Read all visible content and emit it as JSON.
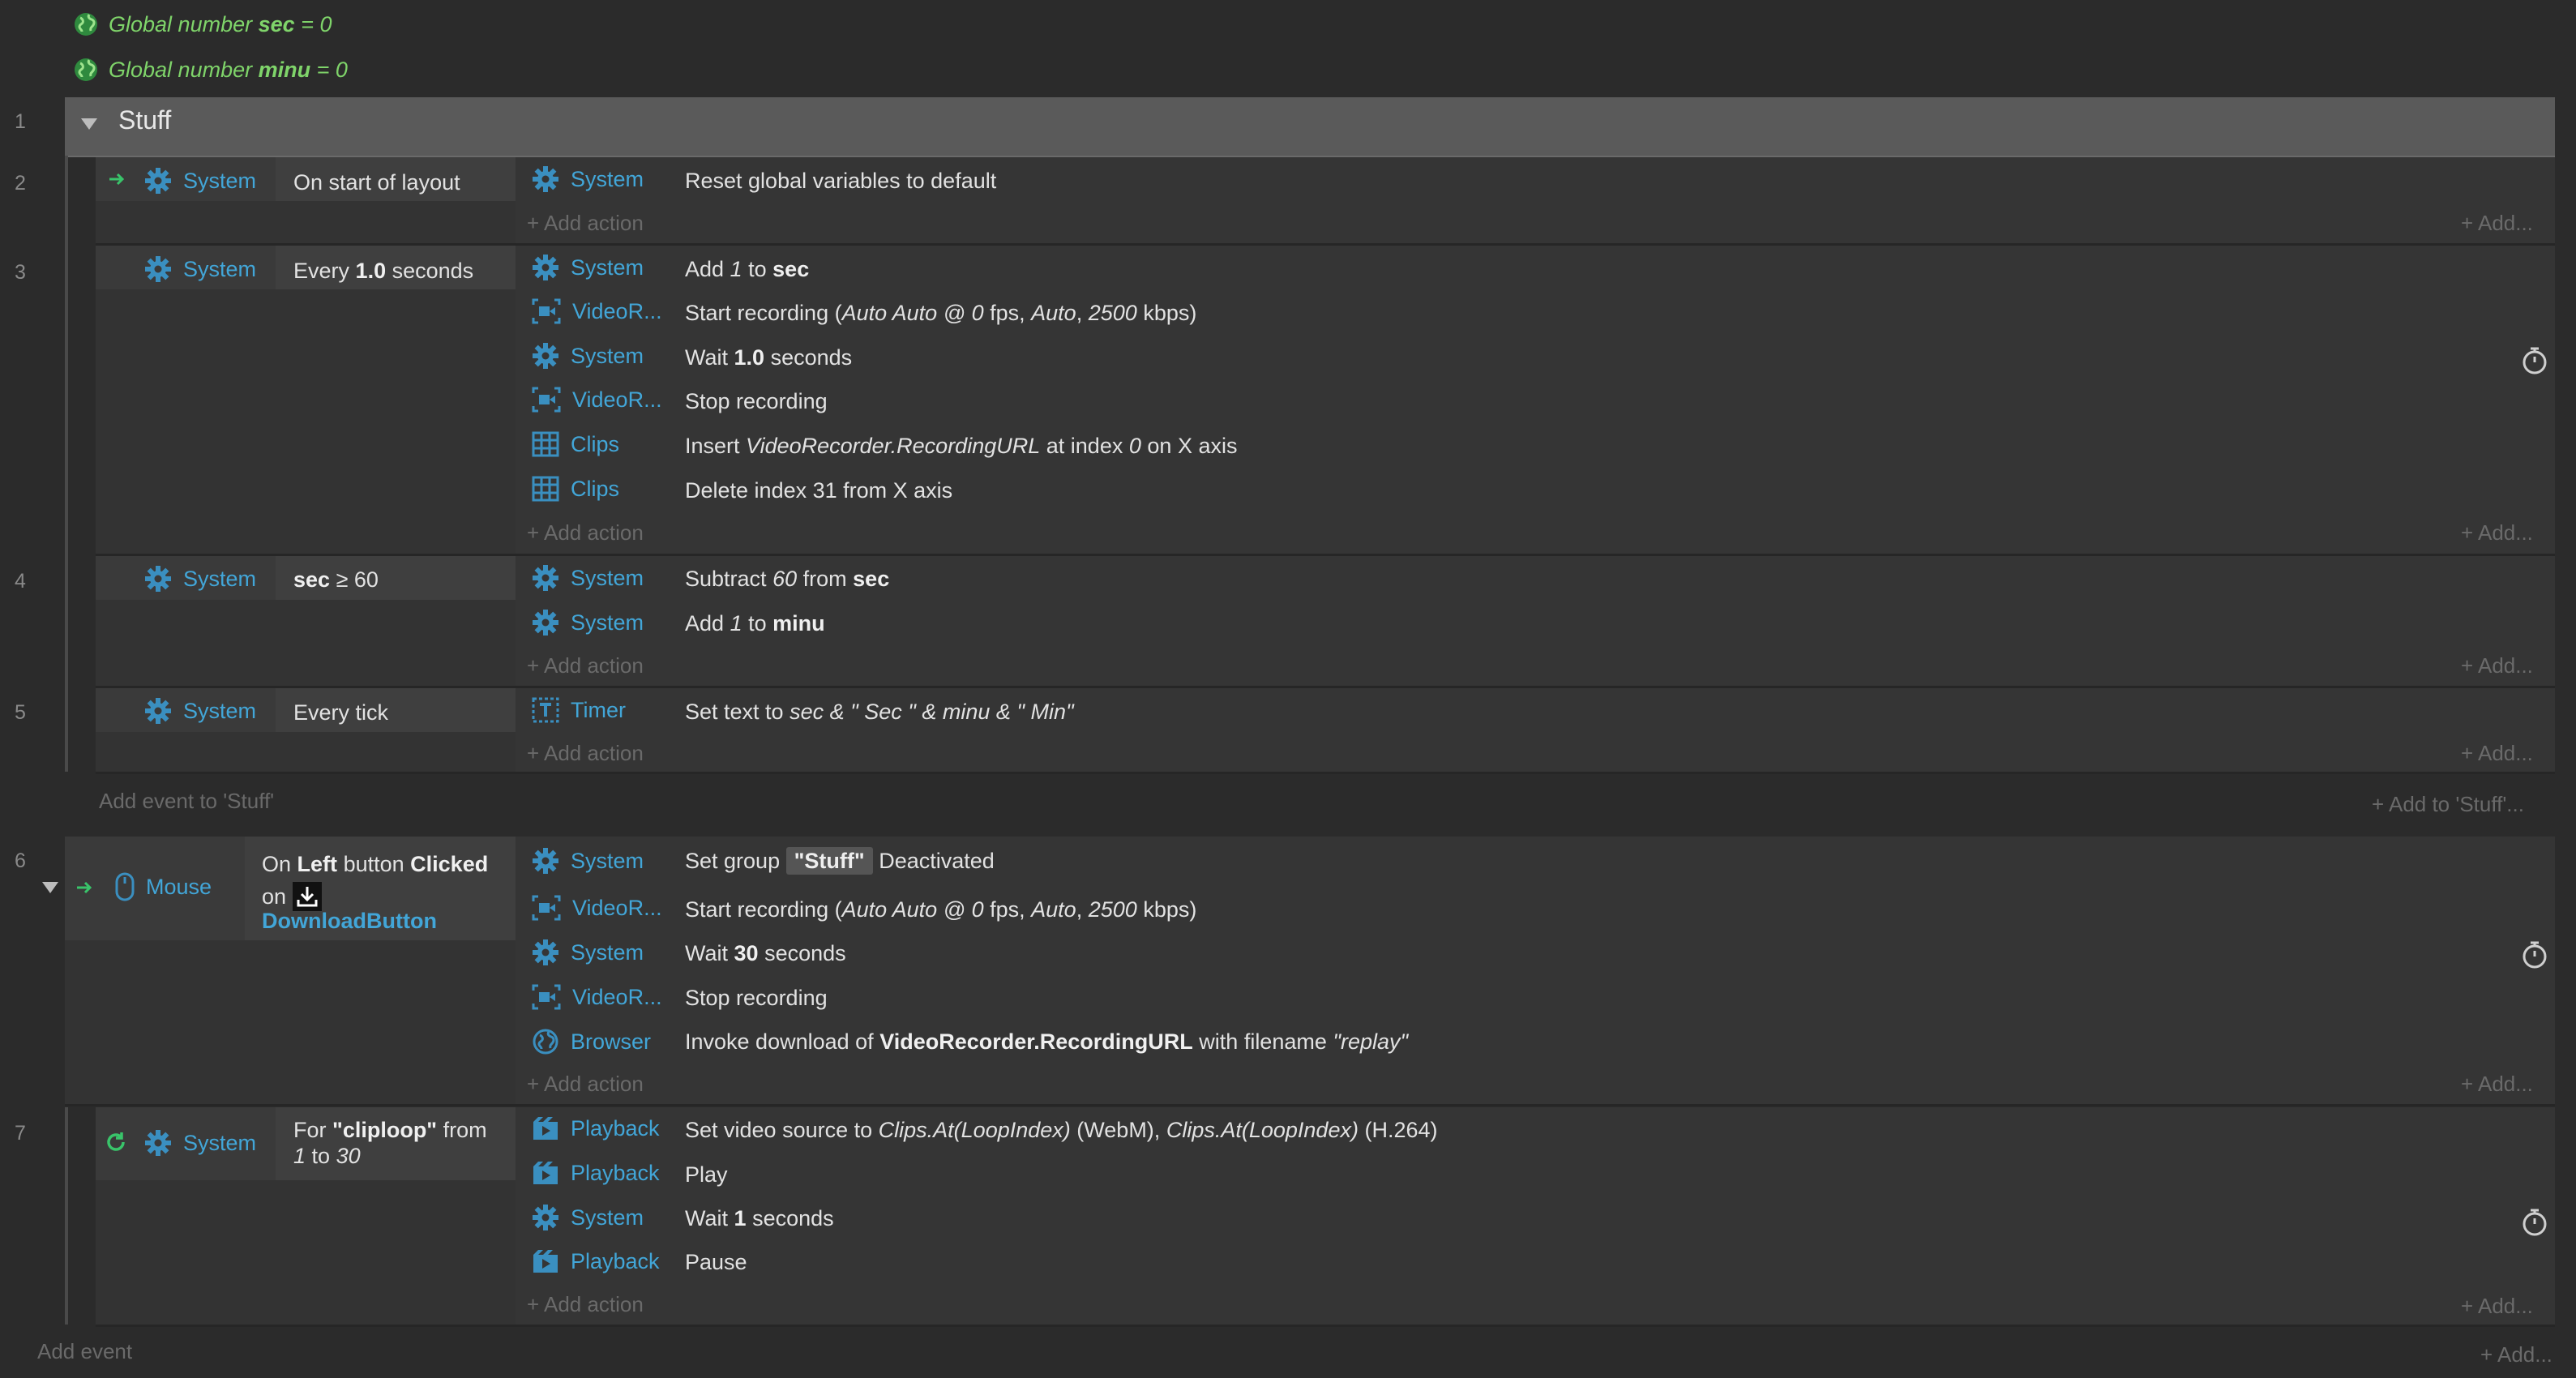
{
  "globals": [
    {
      "prefix": "Global number",
      "name": "sec",
      "suffix": "= 0"
    },
    {
      "prefix": "Global number",
      "name": "minu",
      "suffix": "= 0"
    }
  ],
  "group": {
    "number": "1",
    "title": "Stuff"
  },
  "rows": {
    "r2": {
      "num": "2",
      "obj": "System",
      "cond": "On start of layout"
    },
    "r3": {
      "num": "3",
      "obj": "System",
      "cond_pre": "Every",
      "cond_bold": "1.0",
      "cond_post": "seconds"
    },
    "r4": {
      "num": "4",
      "obj": "System",
      "cond_bold": "sec",
      "cond_post": "≥ 60"
    },
    "r5": {
      "num": "5",
      "obj": "System",
      "cond": "Every tick"
    },
    "r6": {
      "num": "6",
      "obj": "Mouse",
      "c1": "On",
      "c2": "Left",
      "c3": "button",
      "c4": "Clicked",
      "c5": "on",
      "c6": "DownloadButton"
    },
    "r7": {
      "num": "7",
      "obj": "System",
      "c1": "For",
      "c2": "\"cliploop\"",
      "c3": "from",
      "c4": "1",
      "c5": "to",
      "c6": "30"
    }
  },
  "actions": {
    "a2_1": {
      "obj": "System",
      "text": "Reset global variables to default"
    },
    "a3_1": {
      "obj": "System",
      "t1": "Add",
      "t2": "1",
      "t3": "to",
      "t4": "sec"
    },
    "a3_2": {
      "obj": "VideoR...",
      "t1": "Start recording (",
      "t2": "Auto Auto @ 0",
      "t3": "fps,",
      "t4": "Auto",
      "t5": ",",
      "t6": "2500",
      "t7": "kbps)"
    },
    "a3_3": {
      "obj": "System",
      "t1": "Wait",
      "t2": "1.0",
      "t3": "seconds"
    },
    "a3_4": {
      "obj": "VideoR...",
      "text": "Stop recording"
    },
    "a3_5": {
      "obj": "Clips",
      "t1": "Insert",
      "t2": "VideoRecorder.RecordingURL",
      "t3": "at index",
      "t4": "0",
      "t5": "on X axis"
    },
    "a3_6": {
      "obj": "Clips",
      "text": "Delete index 31 from X axis"
    },
    "a4_1": {
      "obj": "System",
      "t1": "Subtract",
      "t2": "60",
      "t3": "from",
      "t4": "sec"
    },
    "a4_2": {
      "obj": "System",
      "t1": "Add",
      "t2": "1",
      "t3": "to",
      "t4": "minu"
    },
    "a5_1": {
      "obj": "Timer",
      "t1": "Set text to",
      "t2": "sec & \" Sec \" & minu & \" Min\""
    },
    "a6_1": {
      "obj": "System",
      "t1": "Set group",
      "t2": "\"Stuff\"",
      "t3": "Deactivated"
    },
    "a6_2": {
      "obj": "VideoR...",
      "t1": "Start recording (",
      "t2": "Auto Auto @ 0",
      "t3": "fps,",
      "t4": "Auto",
      "t5": ",",
      "t6": "2500",
      "t7": "kbps)"
    },
    "a6_3": {
      "obj": "System",
      "t1": "Wait",
      "t2": "30",
      "t3": "seconds"
    },
    "a6_4": {
      "obj": "VideoR...",
      "text": "Stop recording"
    },
    "a6_5": {
      "obj": "Browser",
      "t1": "Invoke download of",
      "t2": "VideoRecorder.RecordingURL",
      "t3": "with filename",
      "t4": "\"replay\""
    },
    "a7_1": {
      "obj": "Playback",
      "t1": "Set video source to",
      "t2": "Clips.At(LoopIndex)",
      "t3": "(WebM),",
      "t4": "Clips.At(LoopIndex)",
      "t5": "(H.264)"
    },
    "a7_2": {
      "obj": "Playback",
      "text": "Play"
    },
    "a7_3": {
      "obj": "System",
      "t1": "Wait",
      "t2": "1",
      "t3": "seconds"
    },
    "a7_4": {
      "obj": "Playback",
      "text": "Pause"
    }
  },
  "labels": {
    "add_action": "+ Add action",
    "add_more": "+ Add...",
    "add_event_group": "Add event to 'Stuff'",
    "add_to_group": "+ Add to 'Stuff'...",
    "add_event": "Add event"
  },
  "colors": {
    "accent": "#42a6d8",
    "global_var": "#7fd46a",
    "trigger_arrow": "#39c46a",
    "background": "#2b2b2b"
  }
}
